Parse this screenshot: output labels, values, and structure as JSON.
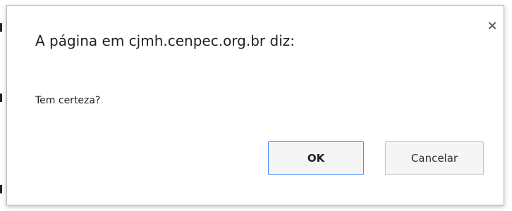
{
  "dialog": {
    "title": "A página em cjmh.cenpec.org.br diz:",
    "message": "Tem certeza?",
    "close_label": "×",
    "ok_label": "OK",
    "cancel_label": "Cancelar"
  },
  "colors": {
    "ok_border": "#4d90fe",
    "button_bg": "#f5f5f5",
    "dialog_border": "#b9b9b9"
  }
}
